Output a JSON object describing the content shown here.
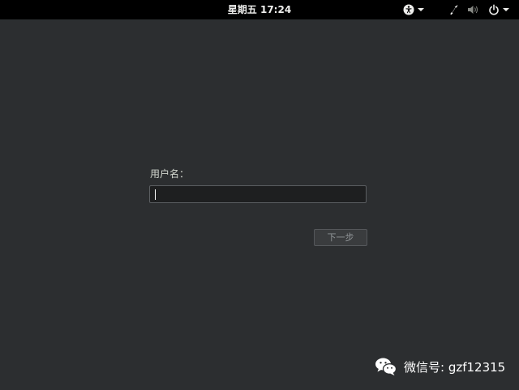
{
  "topbar": {
    "clock": "星期五 17:24",
    "accessibility_icon": "accessibility-icon",
    "network_icon": "network-icon",
    "volume_icon": "volume-icon",
    "power_icon": "power-icon"
  },
  "login": {
    "username_label": "用户名：",
    "username_value": "",
    "next_label": "下一步"
  },
  "watermark": {
    "icon": "wechat-icon",
    "text": "微信号: gzf12315"
  },
  "colors": {
    "background": "#2c2e30",
    "topbar": "#000000",
    "text": "#eeeeec"
  }
}
